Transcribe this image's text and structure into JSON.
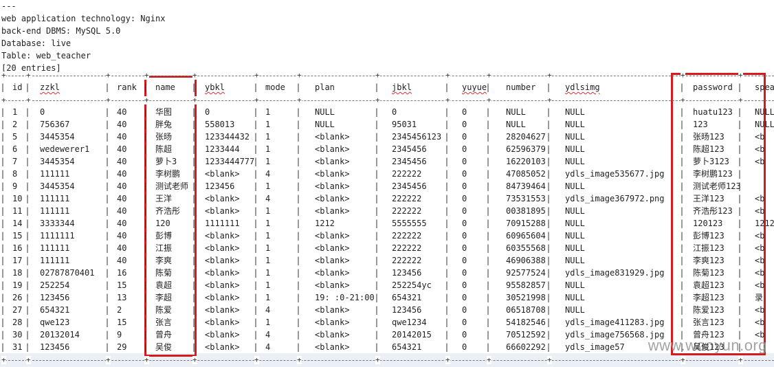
{
  "meta_lines": [
    "---",
    "web application technology: Nginx",
    "back-end DBMS: MySQL 5.0",
    "Database: live",
    "Table: web_teacher",
    "[20 entries]"
  ],
  "table": {
    "columns": [
      "id",
      "zzkl",
      "rank",
      "name",
      "ybkl",
      "mode",
      "plan",
      "jbkl",
      "yuyue",
      "number",
      "ydlsimg",
      "password",
      "speak"
    ],
    "rows": [
      [
        "1",
        "0",
        "40",
        "华图",
        "0",
        "1",
        "NULL",
        "0",
        "0",
        "NULL",
        "NULL",
        "huatu123",
        "NULL"
      ],
      [
        "2",
        "756367",
        "40",
        "胖兔",
        "558013",
        "1",
        "NULL",
        "95031",
        "0",
        "NULL",
        "NULL",
        "123",
        "NULL"
      ],
      [
        "5",
        "3445354",
        "40",
        "张旸",
        "123344432",
        "1",
        "<blank>",
        "2345456123",
        "0",
        "28204627",
        "NULL",
        "张旸123",
        "<b"
      ],
      [
        "6",
        "wedewerer1",
        "40",
        "陈超",
        "1233444",
        "1",
        "<blank>",
        "2345456",
        "0",
        "62596379",
        "NULL",
        "陈超123",
        "<b"
      ],
      [
        "7",
        "3445354",
        "40",
        "萝卜3",
        "1233444777",
        "1",
        "<blank>",
        "2345456",
        "0",
        "16220103",
        "NULL",
        "萝卜3123",
        "<b"
      ],
      [
        "8",
        "111111",
        "40",
        "李树鹏",
        "<blank>",
        "4",
        "<blank>",
        "222222",
        "0",
        "47085052",
        "ydls_image535677.jpg",
        "李树鹏123",
        ""
      ],
      [
        "9",
        "3445354",
        "40",
        "测试老师",
        "123456",
        "1",
        "<blank>",
        "2345456",
        "0",
        "84739464",
        "NULL",
        "测试老师123",
        ""
      ],
      [
        "10",
        "111111",
        "40",
        "王洋",
        "<blank>",
        "4",
        "<blank>",
        "222222",
        "0",
        "73531553",
        "ydls_image367972.png",
        "王洋123",
        "<b"
      ],
      [
        "11",
        "111111",
        "40",
        "齐浩彤",
        "<blank>",
        "1",
        "<blank>",
        "222222",
        "0",
        "00381895",
        "NULL",
        "齐浩彤123",
        "<b"
      ],
      [
        "14",
        "3333344",
        "40",
        "120",
        "1111111",
        "1",
        "1212",
        "5555555",
        "0",
        "70915288",
        "NULL",
        "120123",
        "1212"
      ],
      [
        "15",
        "1111111",
        "40",
        "彭博",
        "<blank>",
        "1",
        "<blank>",
        "222222",
        "0",
        "60965604",
        "NULL",
        "彭博123",
        "<b"
      ],
      [
        "16",
        "111111",
        "40",
        "江振",
        "<blank>",
        "1",
        "<blank>",
        "222222",
        "0",
        "60355568",
        "NULL",
        "江振123",
        "<b"
      ],
      [
        "17",
        "111111",
        "40",
        "李爽",
        "<blank>",
        "1",
        "<blank>",
        "222222",
        "0",
        "46906388",
        "NULL",
        "李爽123",
        "<b"
      ],
      [
        "18",
        "02787870401",
        "16",
        "陈菊",
        "<blank>",
        "1",
        "<blank>",
        "123456",
        "0",
        "92577524",
        "ydls_image831929.jpg",
        "陈菊123",
        "<b"
      ],
      [
        "19",
        "252254",
        "15",
        "袁超",
        "<blank>",
        "1",
        "<blank>",
        "252254yc",
        "0",
        "95582857",
        "NULL",
        "袁超123",
        "<b"
      ],
      [
        "26",
        "123456",
        "13",
        "李超",
        "<blank>",
        "1",
        "19: :0-21:00",
        "654321",
        "0",
        "30521998",
        "NULL",
        "李超123",
        "录"
      ],
      [
        "27",
        "654321",
        "2",
        "陈爱",
        "<blank>",
        "4",
        "<blank>",
        "123456",
        "0",
        "06518708",
        "NULL",
        "陈爱123",
        "<b"
      ],
      [
        "28",
        "qwe123",
        "15",
        "张言",
        "<blank>",
        "1",
        "<blank>",
        "qwe1234",
        "0",
        "54182546",
        "ydls_image411283.jpg",
        "张言123",
        "<b"
      ],
      [
        "30",
        "20132014",
        "9",
        "曾舟",
        "<blank>",
        "4",
        "<blank>",
        "20142015",
        "0",
        "70512592",
        "ydls_image756568.jpg",
        "曾舟123",
        "<b"
      ],
      [
        "31",
        "123456",
        "29",
        "吴俊",
        "<blank>",
        "4",
        "<blank>",
        "654321",
        "0",
        "66602292",
        "ydls_image57",
        "吴俊123",
        ""
      ]
    ]
  },
  "highlight_color": "#d7191c",
  "watermark": "www.wooyun.org"
}
